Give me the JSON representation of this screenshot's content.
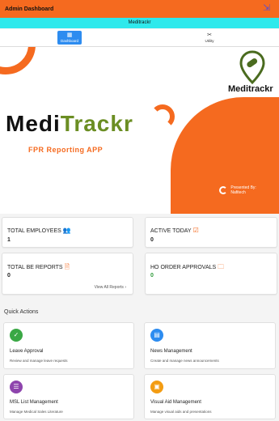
{
  "topbar": {
    "title": "Admin Dashboard",
    "logout_icon": "logout-icon"
  },
  "appbar": {
    "title": "Meditrackr"
  },
  "tabs": [
    {
      "label": "Dashboard",
      "icon": "grid-icon",
      "active": true
    },
    {
      "label": "Utility",
      "icon": "tools-icon",
      "active": false
    }
  ],
  "hero": {
    "brand_small": "Meditrackr",
    "brand_big_part1": "Medi",
    "brand_big_part2": "Trackr",
    "subtitle": "FPR Reporting APP",
    "presented_line1": "Presented By:",
    "presented_line2": "Nafitech",
    "colors": {
      "accent": "#f56a1f",
      "green": "#6b8e23"
    }
  },
  "stats": [
    {
      "label": "TOTAL EMPLOYEES",
      "value": "1",
      "icon": "users-icon",
      "value_color": "#111111"
    },
    {
      "label": "ACTIVE TODAY",
      "value": "0",
      "icon": "calendar-check-icon",
      "value_color": "#111111"
    },
    {
      "label": "TOTAL BE REPORTS",
      "value": "0",
      "icon": "document-icon",
      "value_color": "#111111",
      "link": "View All Reports"
    },
    {
      "label": "HO ORDER APPROVALS",
      "value": "0",
      "icon": "folder-icon",
      "value_color": "#2e9a3a"
    }
  ],
  "quick_actions": {
    "title": "Quick Actions",
    "items": [
      {
        "title": "Leave Approval",
        "desc": "Review and manage leave requests",
        "color": "#3aa845",
        "icon": "check-icon"
      },
      {
        "title": "News Management",
        "desc": "Create and manage news announcements",
        "color": "#2d8cf0",
        "icon": "news-icon"
      },
      {
        "title": "MSL List Management",
        "desc": "Manage Medical Sales Literature",
        "color": "#8e44ad",
        "icon": "list-icon"
      },
      {
        "title": "Visual Aid Management",
        "desc": "Manage visual aids and presentations",
        "color": "#f39c12",
        "icon": "image-icon"
      }
    ]
  }
}
